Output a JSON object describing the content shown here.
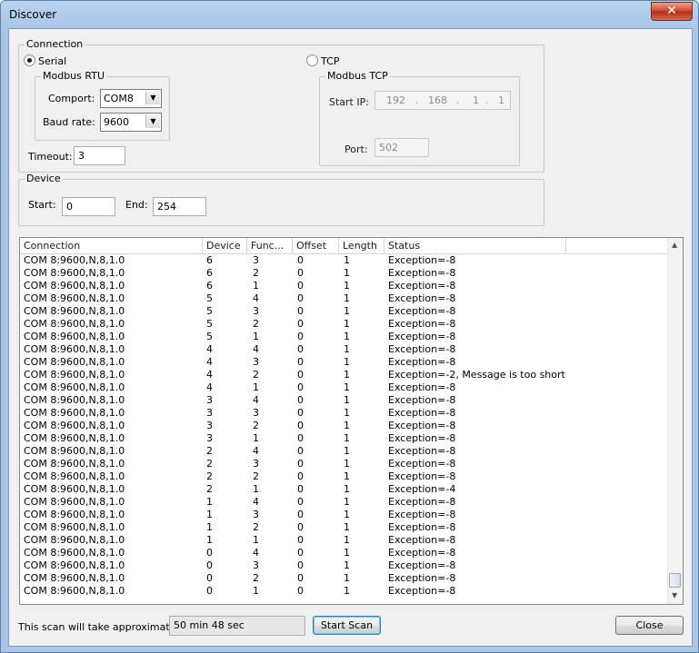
{
  "window": {
    "title": "Discover",
    "close_glyph": "✕"
  },
  "connection": {
    "legend": "Connection",
    "serial_label": "Serial",
    "tcp_label": "TCP",
    "rtu": {
      "legend": "Modbus RTU",
      "comport_label": "Comport:",
      "comport_value": "COM8",
      "baud_label": "Baud rate:",
      "baud_value": "9600"
    },
    "timeout_label": "Timeout:",
    "timeout_value": "3",
    "tcp": {
      "legend": "Modbus TCP",
      "start_ip_label": "Start IP:",
      "ip": [
        "192",
        "168",
        "1",
        "1"
      ],
      "ip_sep": ".",
      "port_label": "Port:",
      "port_value": "502"
    }
  },
  "device": {
    "legend": "Device",
    "start_label": "Start:",
    "start_value": "0",
    "end_label": "End:",
    "end_value": "254"
  },
  "table": {
    "columns": [
      "Connection",
      "Device",
      "Func...",
      "Offset",
      "Length",
      "Status"
    ],
    "rows": [
      [
        "COM 8:9600,N,8,1.0",
        "6",
        "3",
        "0",
        "1",
        "Exception=-8"
      ],
      [
        "COM 8:9600,N,8,1.0",
        "6",
        "2",
        "0",
        "1",
        "Exception=-8"
      ],
      [
        "COM 8:9600,N,8,1.0",
        "6",
        "1",
        "0",
        "1",
        "Exception=-8"
      ],
      [
        "COM 8:9600,N,8,1.0",
        "5",
        "4",
        "0",
        "1",
        "Exception=-8"
      ],
      [
        "COM 8:9600,N,8,1.0",
        "5",
        "3",
        "0",
        "1",
        "Exception=-8"
      ],
      [
        "COM 8:9600,N,8,1.0",
        "5",
        "2",
        "0",
        "1",
        "Exception=-8"
      ],
      [
        "COM 8:9600,N,8,1.0",
        "5",
        "1",
        "0",
        "1",
        "Exception=-8"
      ],
      [
        "COM 8:9600,N,8,1.0",
        "4",
        "4",
        "0",
        "1",
        "Exception=-8"
      ],
      [
        "COM 8:9600,N,8,1.0",
        "4",
        "3",
        "0",
        "1",
        "Exception=-8"
      ],
      [
        "COM 8:9600,N,8,1.0",
        "4",
        "2",
        "0",
        "1",
        "Exception=-2, Message is too short"
      ],
      [
        "COM 8:9600,N,8,1.0",
        "4",
        "1",
        "0",
        "1",
        "Exception=-8"
      ],
      [
        "COM 8:9600,N,8,1.0",
        "3",
        "4",
        "0",
        "1",
        "Exception=-8"
      ],
      [
        "COM 8:9600,N,8,1.0",
        "3",
        "3",
        "0",
        "1",
        "Exception=-8"
      ],
      [
        "COM 8:9600,N,8,1.0",
        "3",
        "2",
        "0",
        "1",
        "Exception=-8"
      ],
      [
        "COM 8:9600,N,8,1.0",
        "3",
        "1",
        "0",
        "1",
        "Exception=-8"
      ],
      [
        "COM 8:9600,N,8,1.0",
        "2",
        "4",
        "0",
        "1",
        "Exception=-8"
      ],
      [
        "COM 8:9600,N,8,1.0",
        "2",
        "3",
        "0",
        "1",
        "Exception=-8"
      ],
      [
        "COM 8:9600,N,8,1.0",
        "2",
        "2",
        "0",
        "1",
        "Exception=-8"
      ],
      [
        "COM 8:9600,N,8,1.0",
        "2",
        "1",
        "0",
        "1",
        "Exception=-4"
      ],
      [
        "COM 8:9600,N,8,1.0",
        "1",
        "4",
        "0",
        "1",
        "Exception=-8"
      ],
      [
        "COM 8:9600,N,8,1.0",
        "1",
        "3",
        "0",
        "1",
        "Exception=-8"
      ],
      [
        "COM 8:9600,N,8,1.0",
        "1",
        "2",
        "0",
        "1",
        "Exception=-8"
      ],
      [
        "COM 8:9600,N,8,1.0",
        "1",
        "1",
        "0",
        "1",
        "Exception=-8"
      ],
      [
        "COM 8:9600,N,8,1.0",
        "0",
        "4",
        "0",
        "1",
        "Exception=-8"
      ],
      [
        "COM 8:9600,N,8,1.0",
        "0",
        "3",
        "0",
        "1",
        "Exception=-8"
      ],
      [
        "COM 8:9600,N,8,1.0",
        "0",
        "2",
        "0",
        "1",
        "Exception=-8"
      ],
      [
        "COM 8:9600,N,8,1.0",
        "0",
        "1",
        "0",
        "1",
        "Exception=-8"
      ]
    ]
  },
  "footer": {
    "estimate_label": "This scan will take approximately:",
    "estimate_value": "50 min 48 sec",
    "start_scan": "Start Scan",
    "close": "Close"
  }
}
